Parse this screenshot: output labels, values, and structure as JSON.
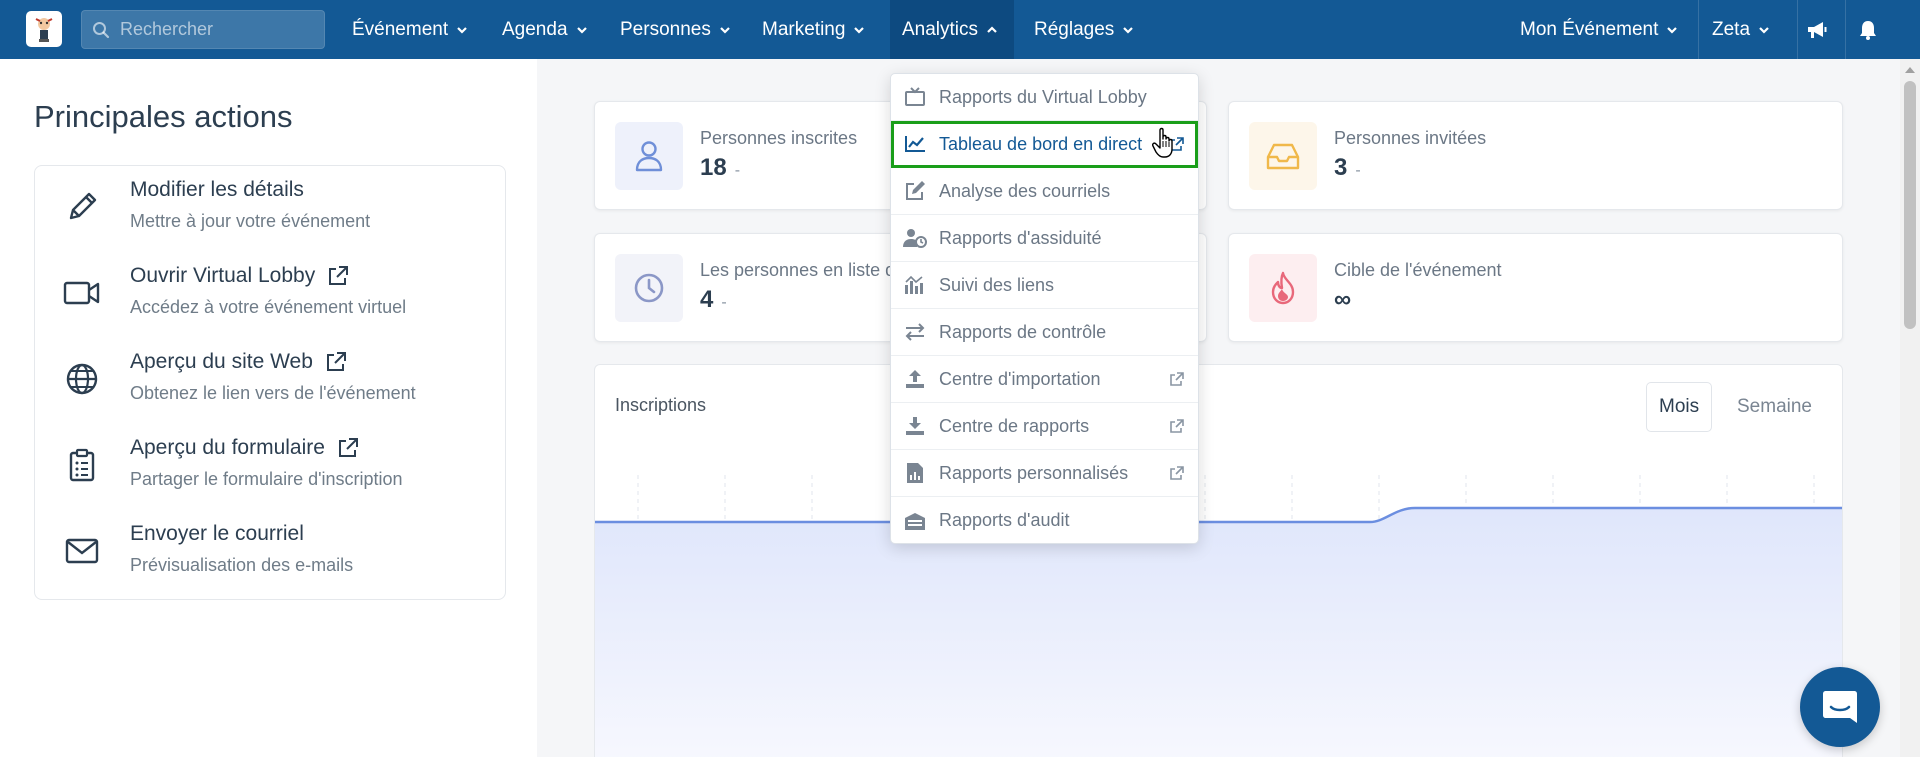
{
  "search": {
    "placeholder": "Rechercher"
  },
  "nav": {
    "items": [
      {
        "label": "Événement"
      },
      {
        "label": "Agenda"
      },
      {
        "label": "Personnes"
      },
      {
        "label": "Marketing"
      },
      {
        "label": "Analytics"
      },
      {
        "label": "Réglages"
      }
    ],
    "event_selector": "Mon Événement",
    "user": "Zeta"
  },
  "left": {
    "title": "Principales actions",
    "actions": [
      {
        "title": "Modifier les détails",
        "subtitle": "Mettre à jour votre événement",
        "icon": "pencil-icon"
      },
      {
        "title": "Ouvrir Virtual Lobby",
        "subtitle": "Accédez à votre événement virtuel",
        "icon": "video-icon"
      },
      {
        "title": "Aperçu du site Web",
        "subtitle": "Obtenez le lien vers de l'événement",
        "icon": "globe-icon"
      },
      {
        "title": "Aperçu du formulaire",
        "subtitle": "Partager le formulaire d'inscription",
        "icon": "clipboard-icon"
      },
      {
        "title": "Envoyer le courriel",
        "subtitle": "Prévisualisation des e-mails",
        "icon": "envelope-icon"
      }
    ]
  },
  "stats": [
    {
      "label": "Personnes inscrites",
      "value": "18",
      "delta": "-",
      "icon": "user-icon",
      "color": "#6f8fd8"
    },
    {
      "label": "Personnes invitées",
      "value": "3",
      "delta": "-",
      "icon": "inbox-icon",
      "color": "#f0b84a"
    },
    {
      "label": "Les personnes en liste d'",
      "value": "4",
      "delta": "-",
      "icon": "clock-icon",
      "color": "#8b97c7"
    },
    {
      "label": "Cible de l'événement",
      "value": "∞",
      "delta": "",
      "icon": "fire-icon",
      "color": "#e8687a"
    }
  ],
  "chart": {
    "title": "Inscriptions",
    "toggle_month": "Mois",
    "toggle_week": "Semaine"
  },
  "dropdown": {
    "items": [
      {
        "label": "Rapports du Virtual Lobby",
        "icon": "tv-icon",
        "external": false
      },
      {
        "label": "Tableau de bord en direct",
        "icon": "line-chart-icon",
        "external": true
      },
      {
        "label": "Analyse des courriels",
        "icon": "edit-icon",
        "external": false
      },
      {
        "label": "Rapports d'assiduité",
        "icon": "user-clock-icon",
        "external": false
      },
      {
        "label": "Suivi des liens",
        "icon": "chart-bars-icon",
        "external": false
      },
      {
        "label": "Rapports de contrôle",
        "icon": "exchange-icon",
        "external": false
      },
      {
        "label": "Centre d'importation",
        "icon": "upload-icon",
        "external": true
      },
      {
        "label": "Centre de rapports",
        "icon": "download-icon",
        "external": true
      },
      {
        "label": "Rapports personnalisés",
        "icon": "file-chart-icon",
        "external": true
      },
      {
        "label": "Rapports d'audit",
        "icon": "archive-icon",
        "external": false
      }
    ]
  },
  "colors": {
    "topbar": "#135995",
    "highlight": "#1a9e1a",
    "chart_line": "#6b8ee0"
  }
}
